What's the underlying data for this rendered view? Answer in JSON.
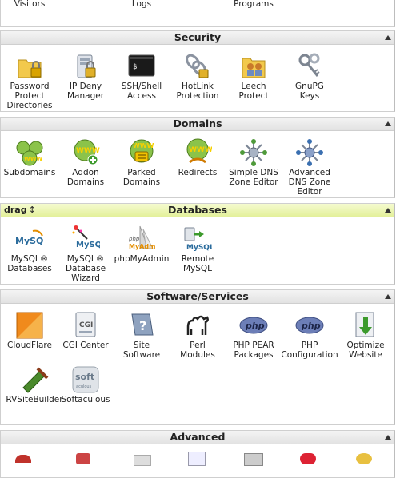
{
  "top_partial": {
    "labels": [
      "Visitors",
      "Logs",
      "Programs"
    ]
  },
  "sections": {
    "security": {
      "title": "Security",
      "items": [
        {
          "label": "Password\nProtect\nDirectories",
          "icon": "folder-lock-icon"
        },
        {
          "label": "IP Deny\nManager",
          "icon": "server-lock-icon"
        },
        {
          "label": "SSH/Shell\nAccess",
          "icon": "terminal-icon"
        },
        {
          "label": "HotLink\nProtection",
          "icon": "chain-lock-icon"
        },
        {
          "label": "Leech\nProtect",
          "icon": "folder-people-icon"
        },
        {
          "label": "GnuPG\nKeys",
          "icon": "keys-icon"
        }
      ]
    },
    "domains": {
      "title": "Domains",
      "items": [
        {
          "label": "Subdomains",
          "icon": "www-globes-icon"
        },
        {
          "label": "Addon\nDomains",
          "icon": "www-add-icon"
        },
        {
          "label": "Parked\nDomains",
          "icon": "www-parked-icon"
        },
        {
          "label": "Redirects",
          "icon": "www-redirect-icon"
        },
        {
          "label": "Simple DNS\nZone Editor",
          "icon": "dns-network-icon"
        },
        {
          "label": "Advanced\nDNS Zone\nEditor",
          "icon": "dns-network-advanced-icon"
        }
      ]
    },
    "databases": {
      "title": "Databases",
      "drag_label": "drag",
      "drag_arrow": "↕",
      "items": [
        {
          "label": "MySQL®\nDatabases",
          "icon": "mysql-icon"
        },
        {
          "label": "MySQL®\nDatabase\nWizard",
          "icon": "mysql-wizard-icon"
        },
        {
          "label": "phpMyAdmin",
          "icon": "phpmyadmin-icon"
        },
        {
          "label": "Remote\nMySQL",
          "icon": "remote-mysql-icon"
        }
      ]
    },
    "software": {
      "title": "Software/Services",
      "items": [
        {
          "label": "CloudFlare",
          "icon": "cloudflare-icon"
        },
        {
          "label": "CGI Center",
          "icon": "cgi-icon"
        },
        {
          "label": "Site\nSoftware",
          "icon": "site-software-icon"
        },
        {
          "label": "Perl\nModules",
          "icon": "perl-camel-icon"
        },
        {
          "label": "PHP PEAR\nPackages",
          "icon": "php-pear-icon"
        },
        {
          "label": "PHP\nConfiguration",
          "icon": "php-config-icon"
        },
        {
          "label": "Optimize\nWebsite",
          "icon": "optimize-icon"
        },
        {
          "label": "RVSiteBuilder",
          "icon": "rvsitebuilder-icon"
        },
        {
          "label": "Softaculous",
          "icon": "softaculous-icon"
        }
      ]
    },
    "advanced": {
      "title": "Advanced"
    }
  },
  "icon_text": {
    "www": "WWW",
    "mysql": "MySQL",
    "php": "php",
    "cgi": "CGI",
    "soft": "soft",
    "soft_sub": "aculous",
    "phpmyadmin": "MyAdmin",
    "shell": "$_"
  },
  "colors": {
    "header_bg": "#e6e6e6",
    "active_header_bg": "#eaf5a8",
    "border": "#cfcfcf",
    "mysql_blue": "#2a6b9c",
    "mysql_orange": "#e48e00",
    "php_purple": "#6c7eb7",
    "folder_yellow": "#f2c94c",
    "www_green": "#8bc34a"
  }
}
